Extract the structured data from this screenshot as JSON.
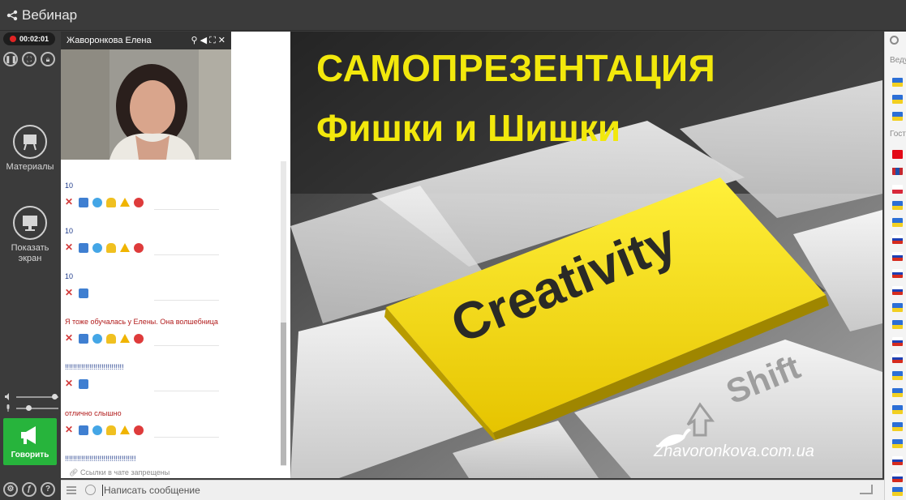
{
  "header": {
    "title": "Вебинар"
  },
  "rail": {
    "recording_time": "00:02:01",
    "materials_label": "Материалы",
    "share_screen_label": "Показать экран",
    "talk_label": "Говорить"
  },
  "video": {
    "presenter_name": "Жаворонкова Елена"
  },
  "chat": {
    "messages": [
      {
        "text": "10"
      },
      {
        "text": "10"
      },
      {
        "text": "10"
      },
      {
        "text": "Я тоже обучалась у Елены. Она волшебница"
      },
      {
        "text": "!!!!!!!!!!!!!!!!!!!!!!!!!!!!!"
      },
      {
        "text": "отлично слышно"
      },
      {
        "text": "!!!!!!!!!!!!!!!!!!!!!!!!!!!!!!!!!!!"
      }
    ],
    "links_note": "Ссылки в чате запрещены"
  },
  "slide": {
    "title_line1": "САМОПРЕЗЕНТАЦИЯ",
    "title_line2": "Фишки и Шишки",
    "key_label": "Creativity",
    "shift_label": "Shift",
    "watermark": "Zhavoronkova.com.ua"
  },
  "participants": {
    "hosts_label": "Ведущие",
    "guests_label": "Гости"
  },
  "input": {
    "placeholder": "Написать сообщение"
  },
  "colors": {
    "accent_green": "#27b43c",
    "slide_yellow": "#f2e80c",
    "record_red": "#e02424"
  }
}
